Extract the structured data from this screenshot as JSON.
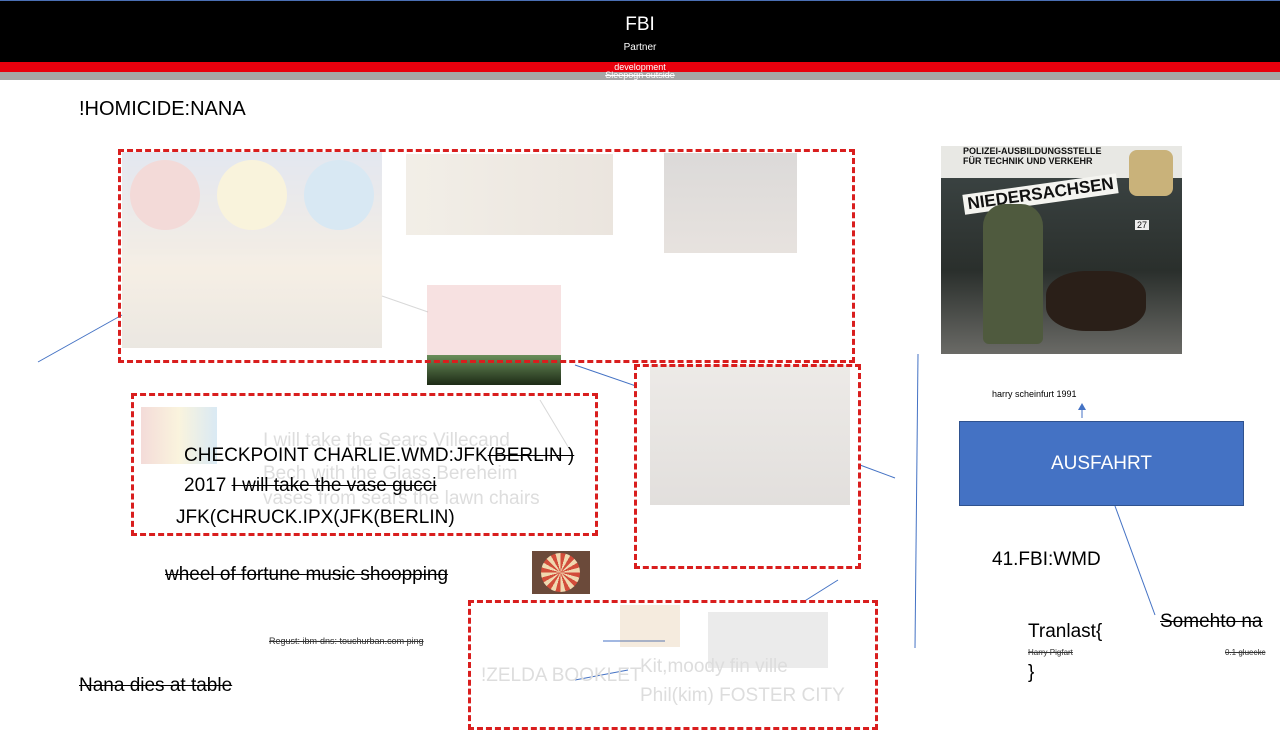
{
  "header": {
    "title": "FBI",
    "subtitle": "Partner",
    "red_bar_text": "development",
    "grey_bar_text": "Sleepogn outside"
  },
  "colors": {
    "header_bg": "#000000",
    "red_bar": "#e8000d",
    "grey_bar": "#a6a6a6",
    "dashed_border": "#d91e1e",
    "box_fill": "#4472c4",
    "line": "#4472c4"
  },
  "texts": {
    "homicide": "!HOMICIDE:NANA",
    "checkpoint_prefix": "CHECKPOINT CHARLIE.WMD:JFK",
    "checkpoint_struck": "(BERLIN )",
    "year": "2017",
    "vase_struck": "I will take the vase gucci",
    "jfk": "JFK(CHRUCK.IPX(JFK(BERLIN)",
    "wheel": "wheel of fortune music shoopping",
    "regust": "Regust: ibm-dns: touchurban.com  ping",
    "nana": "Nana dies at table",
    "harry_caption": "harry scheinfurt 1991",
    "ausfahrt": "AUSFAHRT",
    "fbi_wmd": "41.FBI:WMD",
    "tranlast_open": "Tranlast{",
    "harry_pigfart": "Harry Pigfart",
    "tranlast_close": "}",
    "somehto": "Somehto na",
    "glueck": "0.1 glueckc"
  },
  "ghost_texts": {
    "sears_line1": "I will take the Sears Villecand",
    "sears_line2": "Bech with the Glass Bereheim",
    "sears_line3": "vases from sears the lawn chairs",
    "zelda": "!ZELDA BOOKLET",
    "kit_line1": "Kit,moody fin   ville",
    "kit_line2": "Phil(kim) FOSTER CITY"
  },
  "photo": {
    "sign_line1": "POLIZEI-AUSBILDUNGSSTELLE",
    "sign_line2": "FÜR TECHNIK    UND VERKEHR",
    "sign_line3": "NIEDERSACHSEN",
    "house_number": "27"
  }
}
